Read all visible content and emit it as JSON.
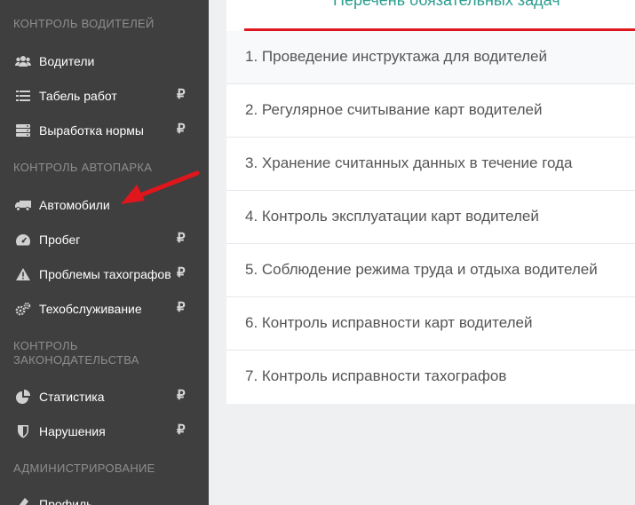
{
  "sidebar": {
    "sections": [
      {
        "title": "КОНТРОЛЬ ВОДИТЕЛЕЙ"
      },
      {
        "title": "КОНТРОЛЬ АВТОПАРКА"
      },
      {
        "title": "КОНТРОЛЬ ЗАКОНОДАТЕЛЬСТВА"
      },
      {
        "title": "АДМИНИСТРИРОВАНИЕ"
      }
    ],
    "items": [
      {
        "label": "Водители",
        "icon": "users-icon",
        "price": ""
      },
      {
        "label": "Табель работ",
        "icon": "list-icon",
        "price": "₽"
      },
      {
        "label": "Выработка нормы",
        "icon": "server-icon",
        "price": "₽"
      },
      {
        "label": "Автомобили",
        "icon": "truck-icon",
        "price": ""
      },
      {
        "label": "Пробег",
        "icon": "dashboard-icon",
        "price": "₽"
      },
      {
        "label": "Проблемы тахографов",
        "icon": "warning-icon",
        "price": "₽"
      },
      {
        "label": "Техобслуживание",
        "icon": "gears-icon",
        "price": "₽"
      },
      {
        "label": "Статистика",
        "icon": "pie-chart-icon",
        "price": "₽"
      },
      {
        "label": "Нарушения",
        "icon": "shield-icon",
        "price": "₽"
      },
      {
        "label": "Профиль",
        "icon": "profile-icon",
        "price": ""
      }
    ]
  },
  "main": {
    "header": "Перечень обязательных задач",
    "rows": [
      "1. Проведение инструктажа для водителей",
      "2. Регулярное считывание карт водителей",
      "3. Хранение считанных данных в течение года",
      "4. Контроль эксплуатации карт водителей",
      "5. Соблюдение режима труда и отдыха водителей",
      "6. Контроль исправности карт водителей",
      "7. Контроль исправности тахографов"
    ]
  },
  "colors": {
    "sidebar_bg": "#3f3f3f",
    "accent_red": "#e0161d",
    "header_teal": "#2a9d8f"
  }
}
